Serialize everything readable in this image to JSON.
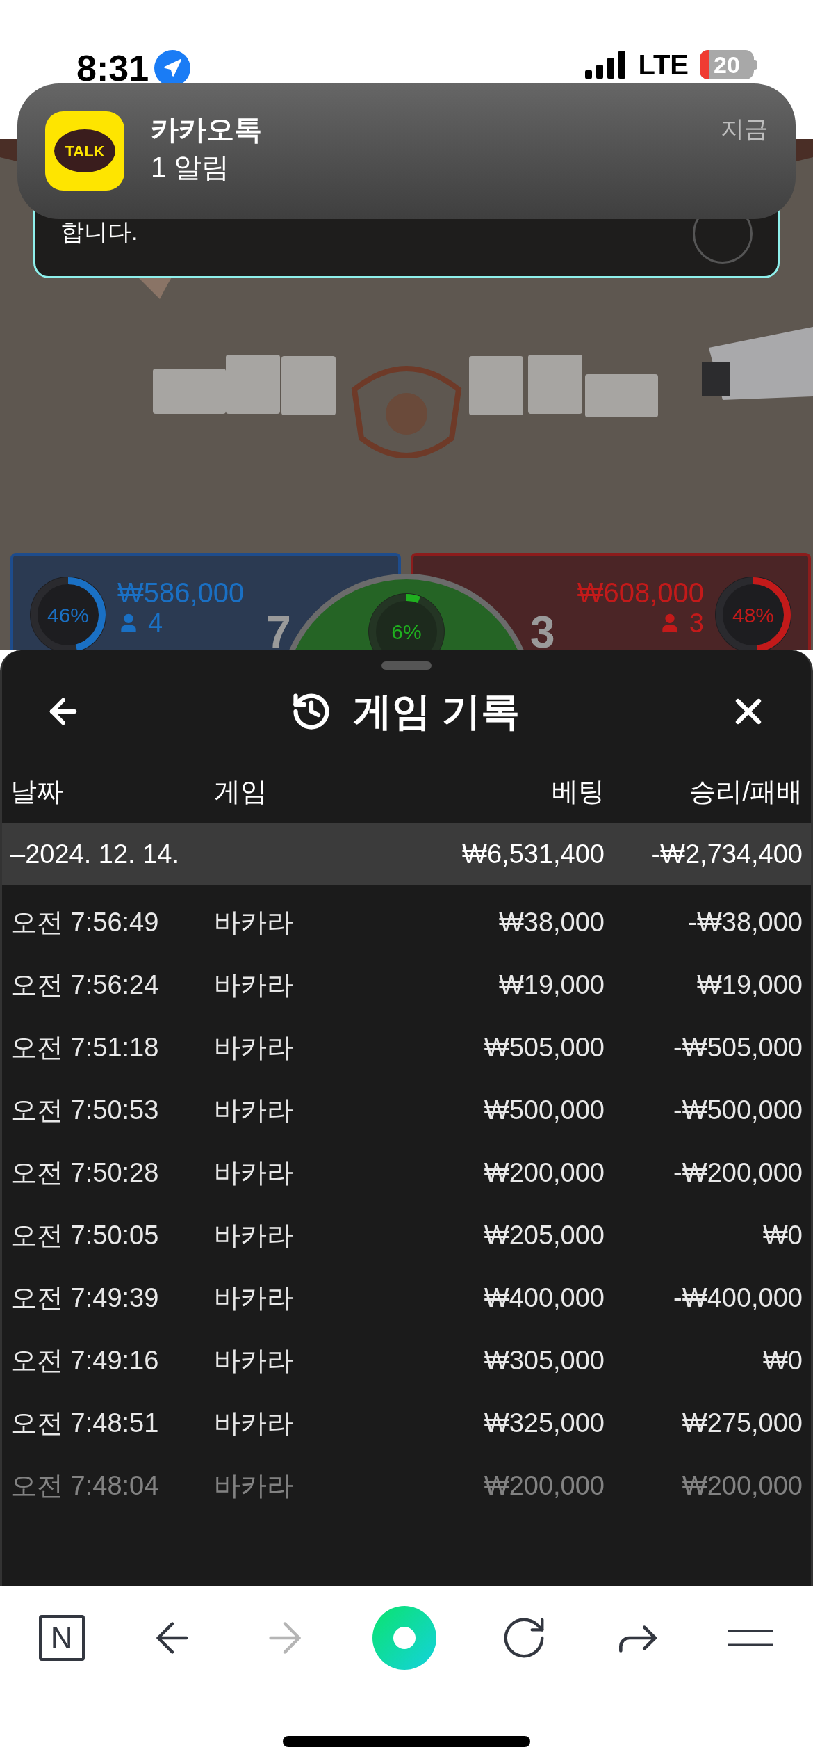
{
  "status_bar": {
    "time": "8:31",
    "network": "LTE",
    "battery": "20"
  },
  "notification": {
    "icon_text": "TALK",
    "app": "카카오톡",
    "message": "1 알림",
    "time": "지금"
  },
  "notice": {
    "text": "합니다."
  },
  "player_panel": {
    "percent": "46%",
    "level": 0.46,
    "amount": "₩586,000",
    "players": "4",
    "score": "7"
  },
  "banker_panel": {
    "percent": "48%",
    "level": 0.48,
    "amount": "₩608,000",
    "players": "3",
    "score": "3"
  },
  "tie_panel": {
    "percent": "6%",
    "level": 0.06
  },
  "sheet": {
    "title": "게임 기록",
    "columns": [
      "날짜",
      "게임",
      "베팅",
      "승리/패배"
    ],
    "group": {
      "date": "–2024. 12. 14.",
      "bet": "₩6,531,400",
      "result": "-₩2,734,400"
    },
    "rows": [
      {
        "time": "오전 7:56:49",
        "game": "바카라",
        "bet": "₩38,000",
        "result": "-₩38,000"
      },
      {
        "time": "오전 7:56:24",
        "game": "바카라",
        "bet": "₩19,000",
        "result": "₩19,000"
      },
      {
        "time": "오전 7:51:18",
        "game": "바카라",
        "bet": "₩505,000",
        "result": "-₩505,000"
      },
      {
        "time": "오전 7:50:53",
        "game": "바카라",
        "bet": "₩500,000",
        "result": "-₩500,000"
      },
      {
        "time": "오전 7:50:28",
        "game": "바카라",
        "bet": "₩200,000",
        "result": "-₩200,000"
      },
      {
        "time": "오전 7:50:05",
        "game": "바카라",
        "bet": "₩205,000",
        "result": "₩0"
      },
      {
        "time": "오전 7:49:39",
        "game": "바카라",
        "bet": "₩400,000",
        "result": "-₩400,000"
      },
      {
        "time": "오전 7:49:16",
        "game": "바카라",
        "bet": "₩305,000",
        "result": "₩0"
      },
      {
        "time": "오전 7:48:51",
        "game": "바카라",
        "bet": "₩325,000",
        "result": "₩275,000"
      },
      {
        "time": "오전 7:48:04",
        "game": "바카라",
        "bet": "₩200,000",
        "result": "₩200,000"
      }
    ]
  },
  "toolbar": [
    {
      "kind": "logo",
      "label": "N",
      "disabled": false
    },
    {
      "kind": "back",
      "disabled": false
    },
    {
      "kind": "forward",
      "disabled": true
    },
    {
      "kind": "home",
      "disabled": false
    },
    {
      "kind": "reload",
      "disabled": false
    },
    {
      "kind": "share",
      "disabled": false
    },
    {
      "kind": "menu",
      "disabled": false
    }
  ]
}
